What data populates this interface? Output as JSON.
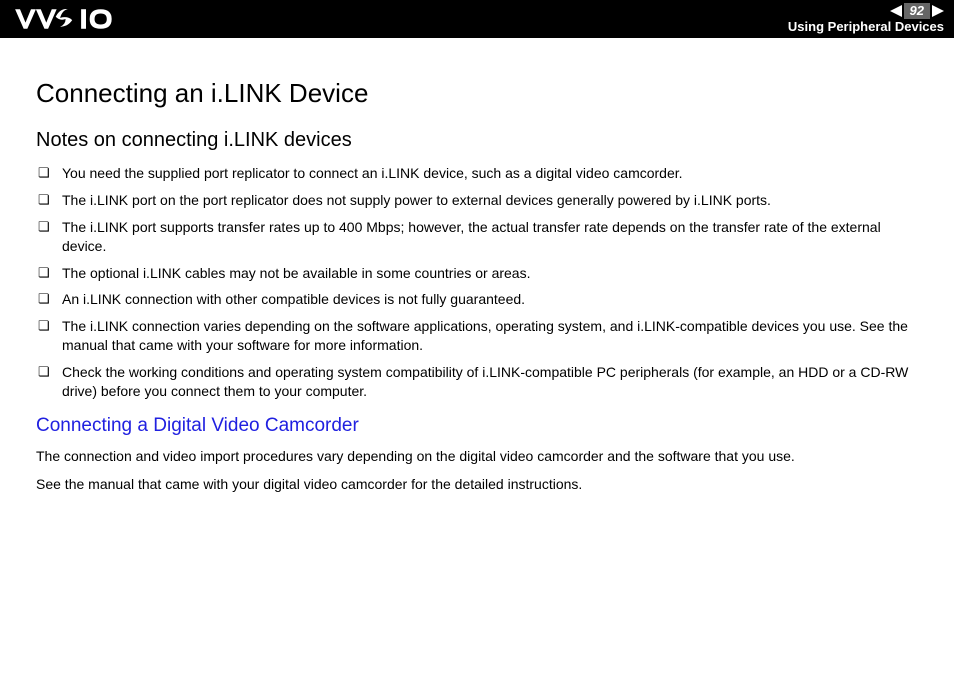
{
  "header": {
    "page_number": "92",
    "section": "Using Peripheral Devices"
  },
  "main": {
    "title": "Connecting an i.LINK Device",
    "subtitle": "Notes on connecting i.LINK devices",
    "notes": [
      "You need the supplied port replicator to connect an i.LINK device, such as a digital video camcorder.",
      "The i.LINK port on the port replicator does not supply power to external devices generally powered by i.LINK ports.",
      "The i.LINK port supports transfer rates up to 400 Mbps; however, the actual transfer rate depends on the transfer rate of the external device.",
      "The optional i.LINK cables may not be available in some countries or areas.",
      "An i.LINK connection with other compatible devices is not fully guaranteed.",
      "The i.LINK connection varies depending on the software applications, operating system, and i.LINK-compatible devices you use. See the manual that came with your software for more information.",
      "Check the working conditions and operating system compatibility of i.LINK-compatible PC peripherals (for example, an HDD or a CD-RW drive) before you connect them to your computer."
    ],
    "subheading": "Connecting a Digital Video Camcorder",
    "paragraphs": [
      "The connection and video import procedures vary depending on the digital video camcorder and the software that you use.",
      "See the manual that came with your digital video camcorder for the detailed instructions."
    ]
  }
}
